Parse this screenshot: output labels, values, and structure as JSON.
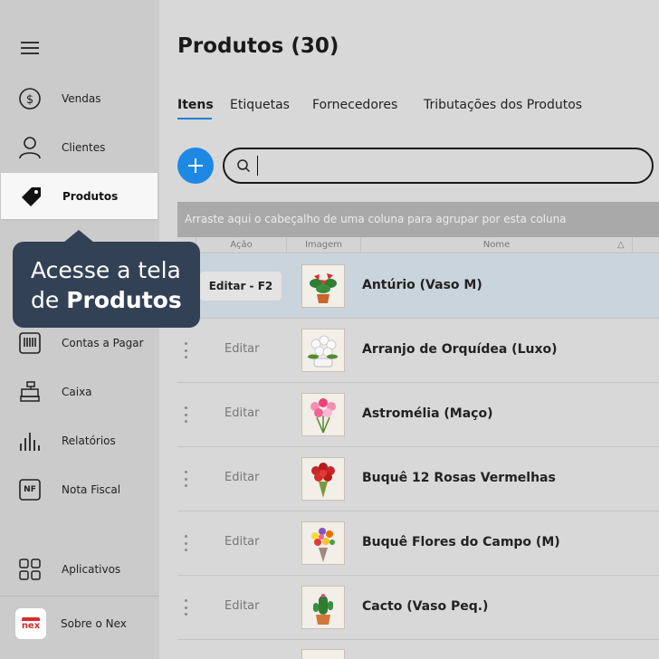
{
  "sidebar": {
    "items": [
      {
        "label": "Vendas",
        "icon": "dollar-circle-icon"
      },
      {
        "label": "Clientes",
        "icon": "user-icon"
      },
      {
        "label": "Produtos",
        "icon": "tag-icon",
        "active": true
      },
      {
        "label": "Contas a Pagar",
        "icon": "barcode-icon"
      },
      {
        "label": "Caixa",
        "icon": "cash-register-icon"
      },
      {
        "label": "Relatórios",
        "icon": "bar-chart-icon"
      },
      {
        "label": "Nota Fiscal",
        "icon": "nf-icon",
        "icon_text": "NF"
      },
      {
        "label": "Aplicativos",
        "icon": "apps-grid-icon"
      }
    ],
    "about_label": "Sobre o Nex",
    "logo_text": "nex"
  },
  "tooltip": {
    "line1": "Acesse a tela",
    "line2_prefix": "de ",
    "line2_bold": "Produtos"
  },
  "main": {
    "title": "Produtos (30)",
    "tabs": [
      "Itens",
      "Etiquetas",
      "Fornecedores",
      "Tributações dos Produtos"
    ],
    "search": {
      "value": "",
      "placeholder": ""
    },
    "group_panel_text": "Arraste aqui o cabeçalho de uma coluna para agrupar por esta coluna",
    "columns": {
      "action": "Ação",
      "image": "Imagem",
      "name": "Nome",
      "sort_indicator": "△"
    },
    "edit_selected_label": "Editar - F2",
    "edit_label": "Editar",
    "rows": [
      {
        "name": "Antúrio (Vaso M)",
        "selected": true,
        "flower": "red-pot"
      },
      {
        "name": "Arranjo de Orquídea (Luxo)",
        "flower": "white-orchid"
      },
      {
        "name": "Astromélia (Maço)",
        "flower": "pink-bouquet"
      },
      {
        "name": "Buquê 12 Rosas Vermelhas",
        "flower": "red-roses"
      },
      {
        "name": "Buquê Flores do Campo (M)",
        "flower": "mixed-bouquet"
      },
      {
        "name": "Cacto (Vaso Peq.)",
        "flower": "cactus"
      }
    ]
  },
  "colors": {
    "accent": "#1e88e5",
    "tooltip_bg": "#334155",
    "selected_row": "#c9d4dc",
    "logo_red": "#d62c2c"
  }
}
